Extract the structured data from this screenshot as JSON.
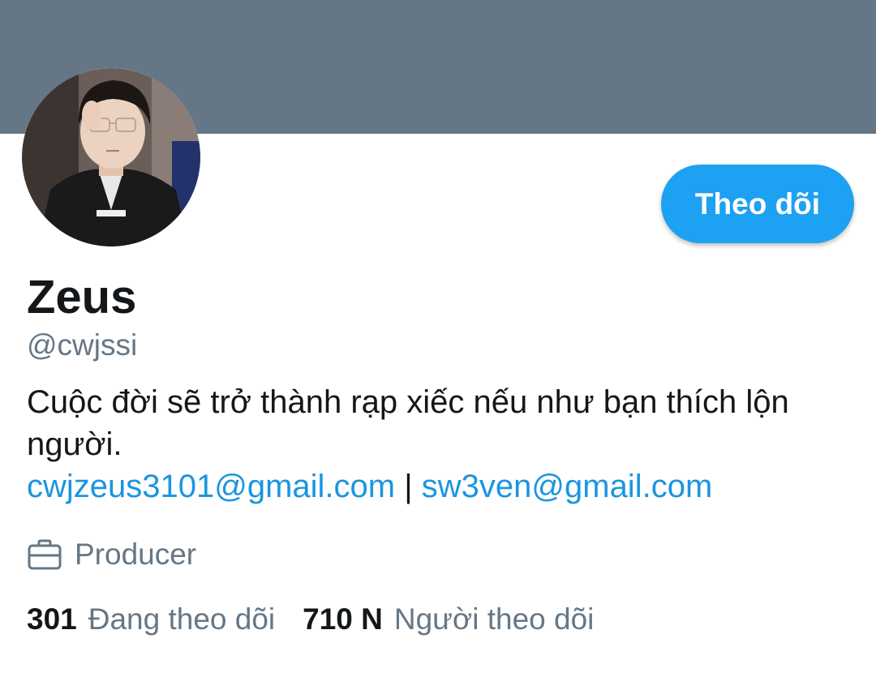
{
  "profile": {
    "display_name": "Zeus",
    "handle": "@cwjssi",
    "bio": "Cuộc đời sẽ trở thành rạp xiếc nếu như bạn thích lộn người.",
    "email_1": "cwjzeus3101@gmail.com",
    "separator": "|",
    "email_2": "sw3ven@gmail.com",
    "occupation": "Producer",
    "occupation_icon": "briefcase-icon"
  },
  "actions": {
    "follow_label": "Theo dõi"
  },
  "stats": {
    "following_count": "301",
    "following_label": "Đang theo dõi",
    "followers_count": "710 N",
    "followers_label": "Người theo dõi"
  },
  "colors": {
    "banner": "#657786",
    "accent": "#1da1f2",
    "link": "#1b95e0",
    "text_primary": "#14171a",
    "text_secondary": "#657786"
  }
}
